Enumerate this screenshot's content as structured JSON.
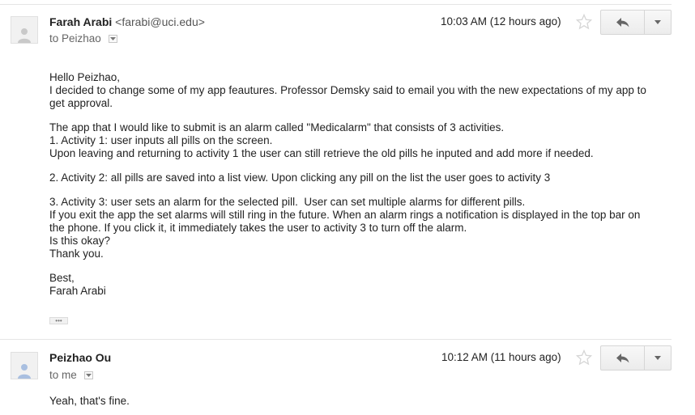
{
  "messages": [
    {
      "sender_name": "Farah Arabi",
      "sender_email": "<farabi@uci.edu>",
      "to": "to Peizhao",
      "time": "10:03 AM (12 hours ago)",
      "body": [
        "Hello Peizhao,",
        "I decided to change some of my app feautures. Professor Demsky said to email you with the new expectations of my app to get approval.",
        "",
        "The app that I would like to submit is an alarm called \"Medicalarm\" that consists of 3 activities.",
        "1. Activity 1: user inputs all pills on the screen.",
        "Upon leaving and returning to activity 1 the user can still retrieve the old pills he inputed and add more if needed.",
        "",
        "2. Activity 2: all pills are saved into a list view. Upon clicking any pill on the list the user goes to activity 3",
        "",
        "3. Activity 3: user sets an alarm for the selected pill.  User can set multiple alarms for different pills.",
        "If you exit the app the set alarms will still ring in the future. When an alarm rings a notification is displayed in the top bar on the phone. If you click it, it immediately takes the user to activity 3 to turn off the alarm.",
        "Is this okay?",
        "Thank you.",
        "",
        "Best,",
        "Farah Arabi"
      ],
      "show_trimmed": "•••"
    },
    {
      "sender_name": "Peizhao Ou",
      "to": "to me",
      "time": "10:12 AM (11 hours ago)",
      "body": [
        "Yeah, that's fine."
      ]
    }
  ],
  "icons": {
    "avatar": "person-icon",
    "star": "star-icon",
    "reply": "reply-arrow-icon",
    "more": "chevron-down-icon",
    "to_dropdown": "dropdown-arrow-icon"
  },
  "colors": {
    "star": "#e0e0e0",
    "icon_gray": "#666666",
    "separator": "#e5e5e5"
  }
}
